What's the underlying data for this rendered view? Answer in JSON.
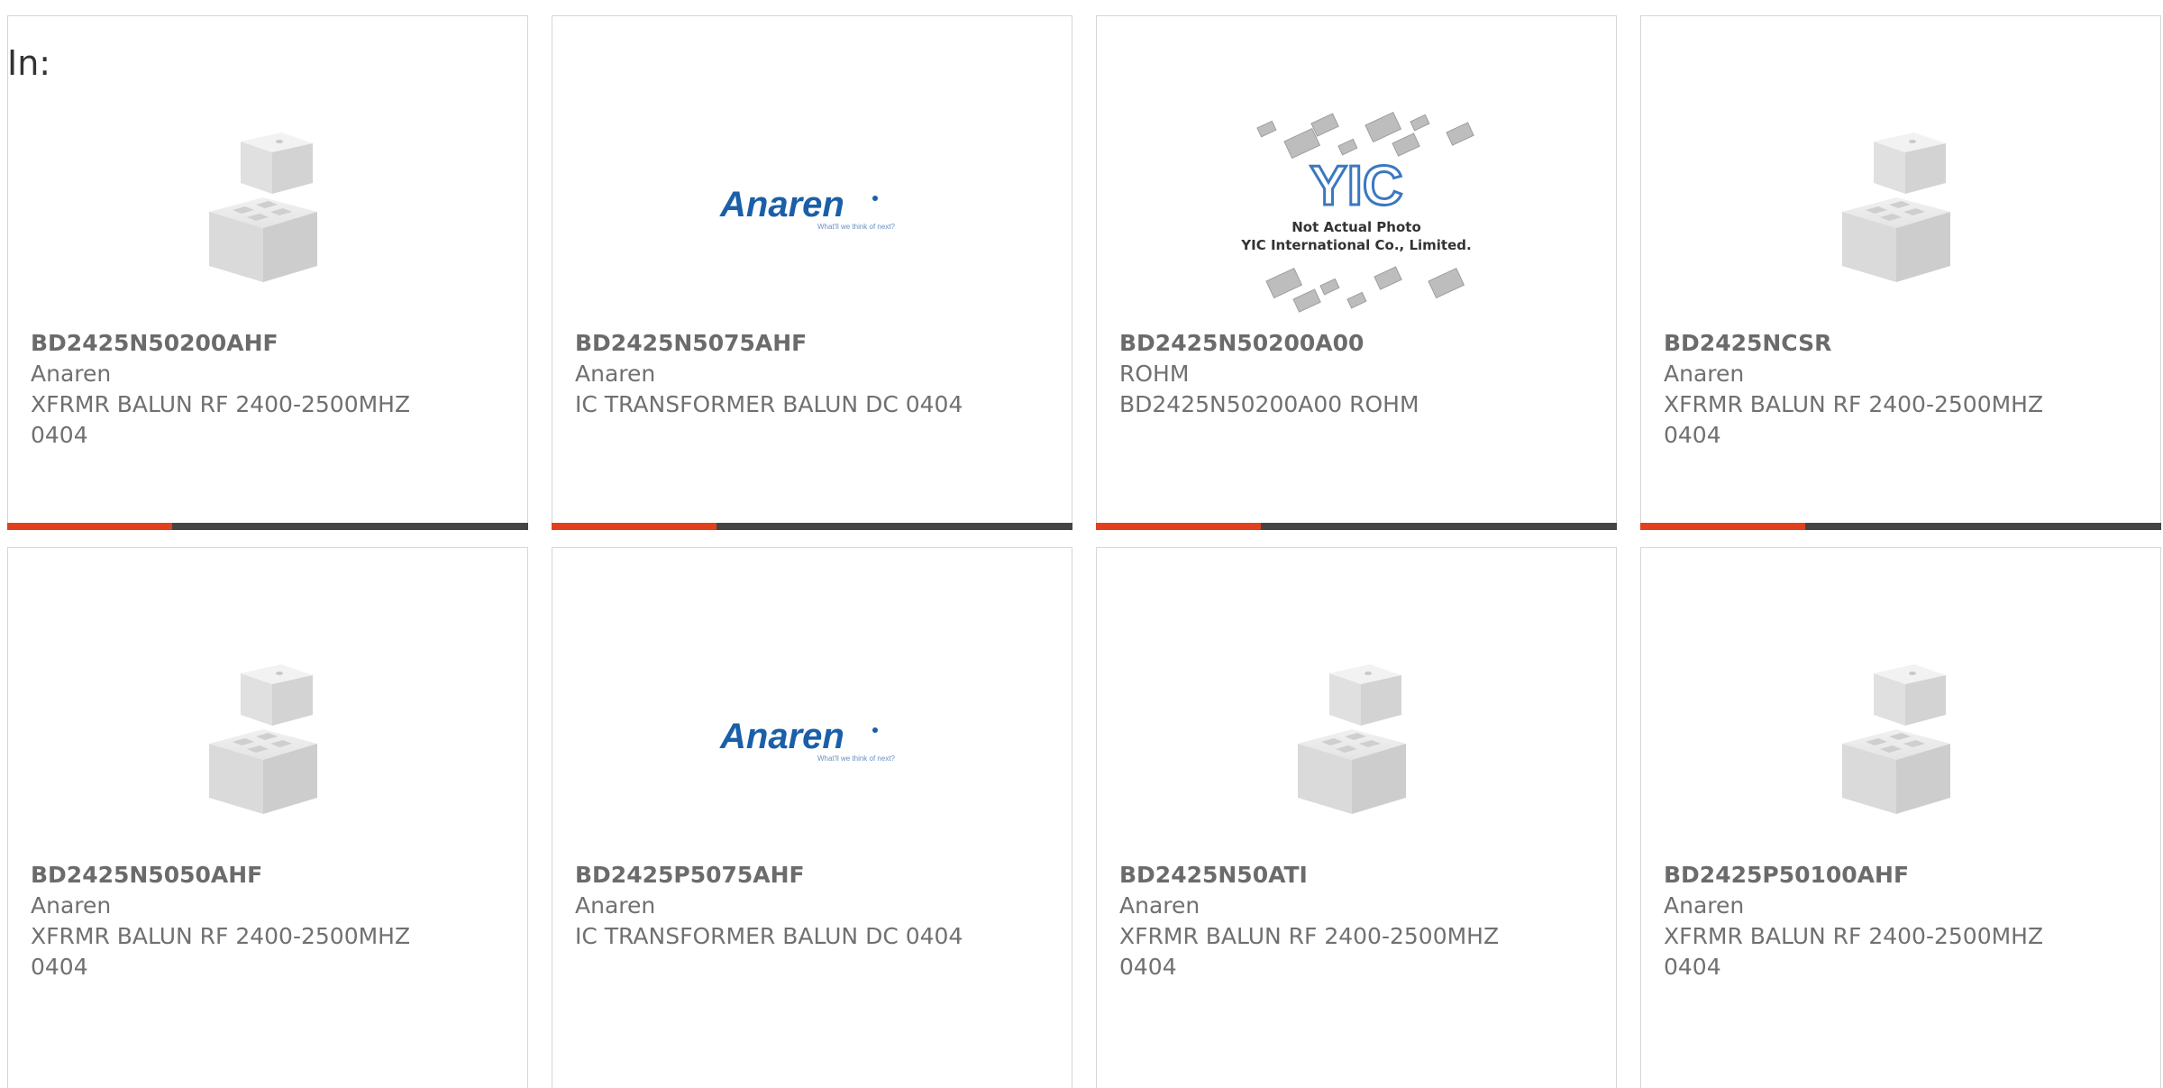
{
  "filter_label": "In:",
  "colors": {
    "accent": "#e2401d",
    "bar": "#444444",
    "border": "#d6d6d6",
    "anaren_blue": "#1a5fa8",
    "yic_blue": "#3a78c2"
  },
  "products": [
    {
      "part_number": "BD2425N50200AHF",
      "manufacturer": "Anaren",
      "description": "XFRMR BALUN RF 2400-2500MHZ 0404",
      "image": "generic-chip-icon"
    },
    {
      "part_number": "BD2425N5075AHF",
      "manufacturer": "Anaren",
      "description": "IC TRANSFORMER BALUN DC 0404",
      "image": "anaren-logo",
      "logo": {
        "name": "Anaren",
        "tagline": "What'll we think of next?"
      }
    },
    {
      "part_number": "BD2425N50200A00",
      "manufacturer": "ROHM",
      "description": "BD2425N50200A00 ROHM",
      "image": "yic-placeholder",
      "placeholder": {
        "logo": "YIC",
        "line1": "Not Actual Photo",
        "line2": "YIC International Co., Limited."
      }
    },
    {
      "part_number": "BD2425NCSR",
      "manufacturer": "Anaren",
      "description": "XFRMR BALUN RF 2400-2500MHZ 0404",
      "image": "generic-chip-icon"
    },
    {
      "part_number": "BD2425N5050AHF",
      "manufacturer": "Anaren",
      "description": "XFRMR BALUN RF 2400-2500MHZ 0404",
      "image": "generic-chip-icon"
    },
    {
      "part_number": "BD2425P5075AHF",
      "manufacturer": "Anaren",
      "description": "IC TRANSFORMER BALUN DC 0404",
      "image": "anaren-logo",
      "logo": {
        "name": "Anaren",
        "tagline": "What'll we think of next?"
      }
    },
    {
      "part_number": "BD2425N50ATI",
      "manufacturer": "Anaren",
      "description": "XFRMR BALUN RF 2400-2500MHZ 0404",
      "image": "generic-chip-icon"
    },
    {
      "part_number": "BD2425P50100AHF",
      "manufacturer": "Anaren",
      "description": "XFRMR BALUN RF 2400-2500MHZ 0404",
      "image": "generic-chip-icon"
    }
  ]
}
